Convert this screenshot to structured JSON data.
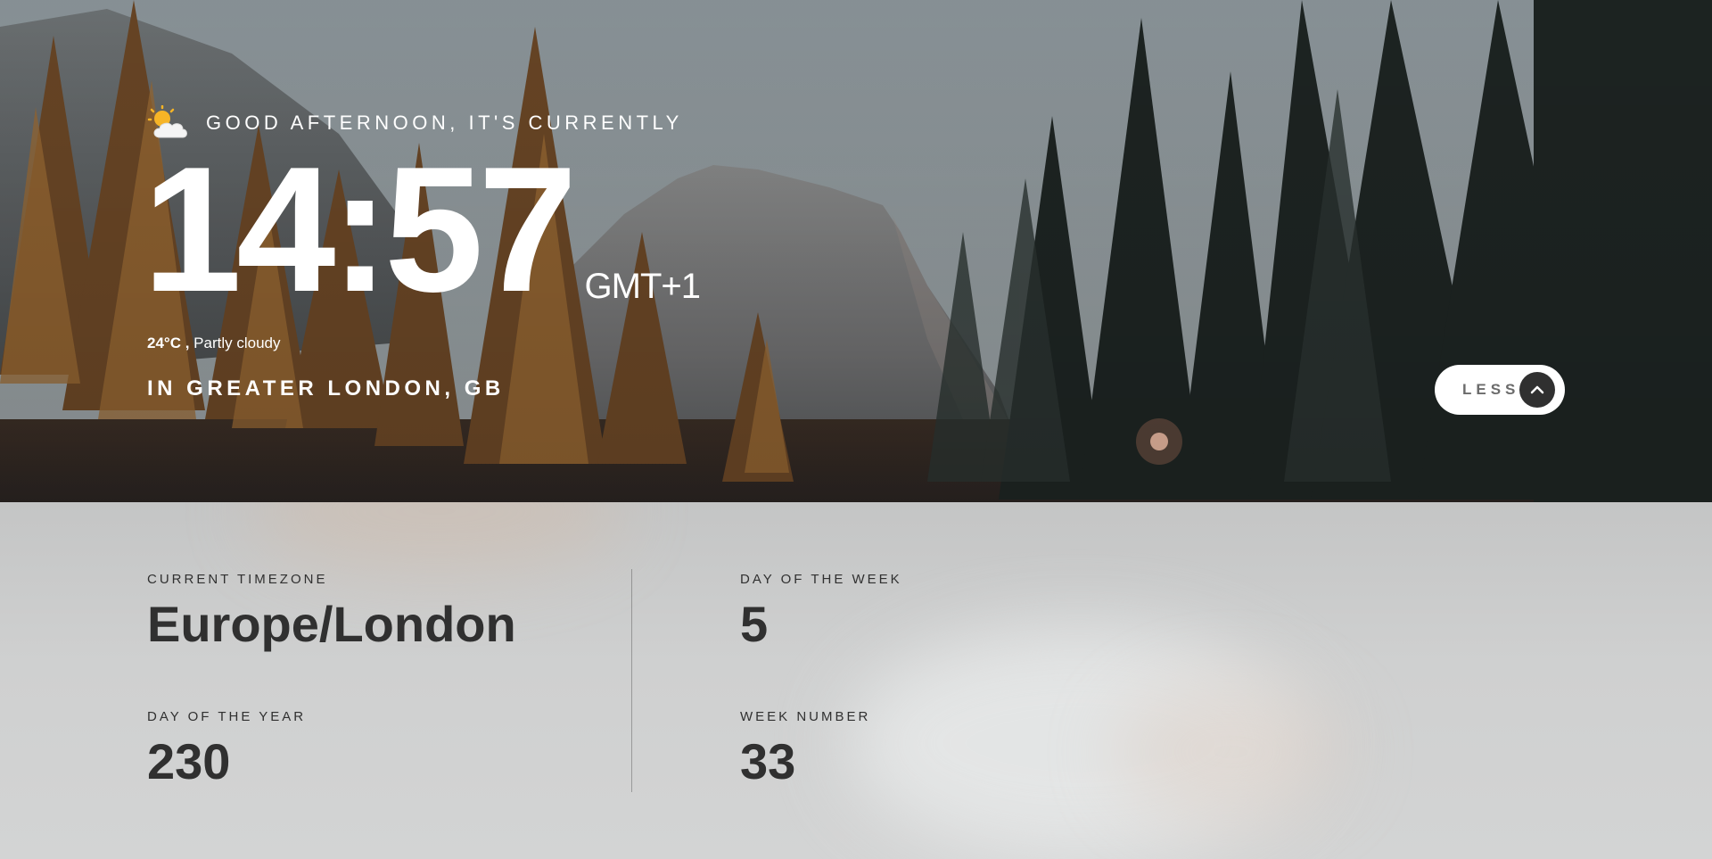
{
  "greeting": {
    "icon": "sun-behind-cloud-icon",
    "text": "GOOD AFTERNOON, IT'S CURRENTLY"
  },
  "clock": {
    "time": "14:57",
    "timezone_abbr": "GMT+1"
  },
  "weather": {
    "temperature": "24°C",
    "separator": " ,",
    "condition": "Partly cloudy"
  },
  "location": "IN GREATER LONDON, GB",
  "toggle": {
    "label": "LESS",
    "icon": "chevron-up-icon"
  },
  "details": {
    "current_timezone": {
      "label": "CURRENT TIMEZONE",
      "value": "Europe/London"
    },
    "day_of_year": {
      "label": "DAY OF THE YEAR",
      "value": "230"
    },
    "day_of_week": {
      "label": "DAY OF THE WEEK",
      "value": "5"
    },
    "week_number": {
      "label": "WEEK NUMBER",
      "value": "33"
    }
  },
  "colors": {
    "text_light": "#ffffff",
    "text_dark": "#303030",
    "button_bg": "#ffffff",
    "button_arrow_bg": "#303030",
    "panel_bg": "#cfd0d0"
  }
}
